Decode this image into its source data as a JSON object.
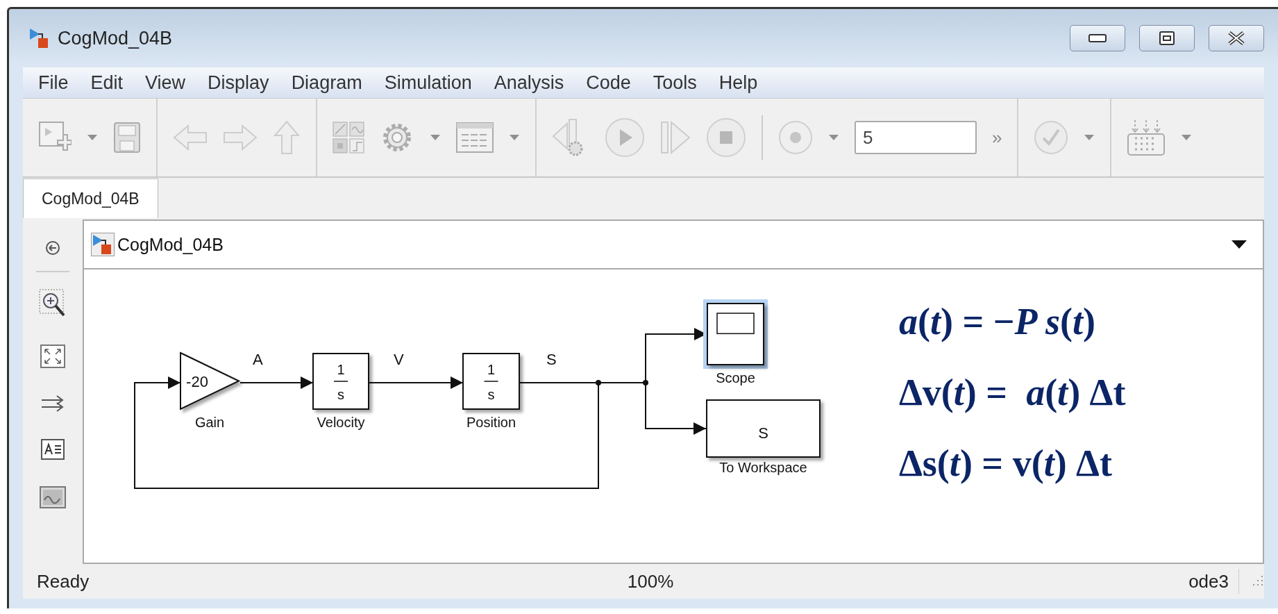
{
  "window": {
    "title": "CogMod_04B"
  },
  "menu": [
    "File",
    "Edit",
    "View",
    "Display",
    "Diagram",
    "Simulation",
    "Analysis",
    "Code",
    "Tools",
    "Help"
  ],
  "toolbar": {
    "groups": [
      {
        "items": [
          {
            "kind": "new-model",
            "disabled": true
          },
          {
            "kind": "caret",
            "disabled": true
          },
          {
            "kind": "save",
            "disabled": true
          }
        ]
      },
      {
        "items": [
          {
            "kind": "back",
            "disabled": true
          },
          {
            "kind": "forward",
            "disabled": true
          },
          {
            "kind": "up",
            "disabled": true
          }
        ]
      },
      {
        "items": [
          {
            "kind": "library",
            "disabled": true
          },
          {
            "kind": "settings",
            "disabled": true
          },
          {
            "kind": "caret",
            "disabled": true
          },
          {
            "kind": "explorer",
            "disabled": true
          },
          {
            "kind": "caret",
            "disabled": true
          }
        ]
      },
      {
        "items": [
          {
            "kind": "step-back",
            "disabled": true
          },
          {
            "kind": "run",
            "disabled": true
          },
          {
            "kind": "step-forward",
            "disabled": true
          },
          {
            "kind": "stop",
            "disabled": true
          },
          {
            "kind": "divider"
          },
          {
            "kind": "record",
            "disabled": true
          },
          {
            "kind": "caret",
            "disabled": true
          },
          {
            "kind": "field",
            "value": "5"
          },
          {
            "kind": "overflow",
            "text": "»"
          }
        ]
      },
      {
        "items": [
          {
            "kind": "check",
            "disabled": true
          },
          {
            "kind": "caret",
            "disabled": true
          }
        ]
      },
      {
        "items": [
          {
            "kind": "keypad",
            "disabled": true
          },
          {
            "kind": "caret",
            "disabled": true
          }
        ]
      }
    ]
  },
  "tabs": [
    {
      "label": "CogMod_04B",
      "selected": true
    }
  ],
  "address": {
    "path": "CogMod_04B"
  },
  "diagram": {
    "blocks": [
      {
        "kind": "gain",
        "value": "-20",
        "label": "Gain",
        "selected": false
      },
      {
        "kind": "integrator",
        "numerator": "1",
        "denominator": "s",
        "label": "Velocity",
        "selected": false
      },
      {
        "kind": "integrator",
        "numerator": "1",
        "denominator": "s",
        "label": "Position",
        "selected": false
      },
      {
        "kind": "scope",
        "label": "Scope",
        "selected": true
      },
      {
        "kind": "workspace",
        "value": "S",
        "label": "To Workspace",
        "selected": false
      }
    ],
    "signals": [
      "A",
      "V",
      "S"
    ]
  },
  "equations": [
    "*a*(*t*) = −*P s*(*t*)",
    "Δv(*t*) =  *a*(*t*) Δt",
    "Δs(*t*) = v(*t*) Δt"
  ],
  "status_bar": {
    "state": "Ready",
    "zoom": "100%",
    "solver": "ode3"
  }
}
